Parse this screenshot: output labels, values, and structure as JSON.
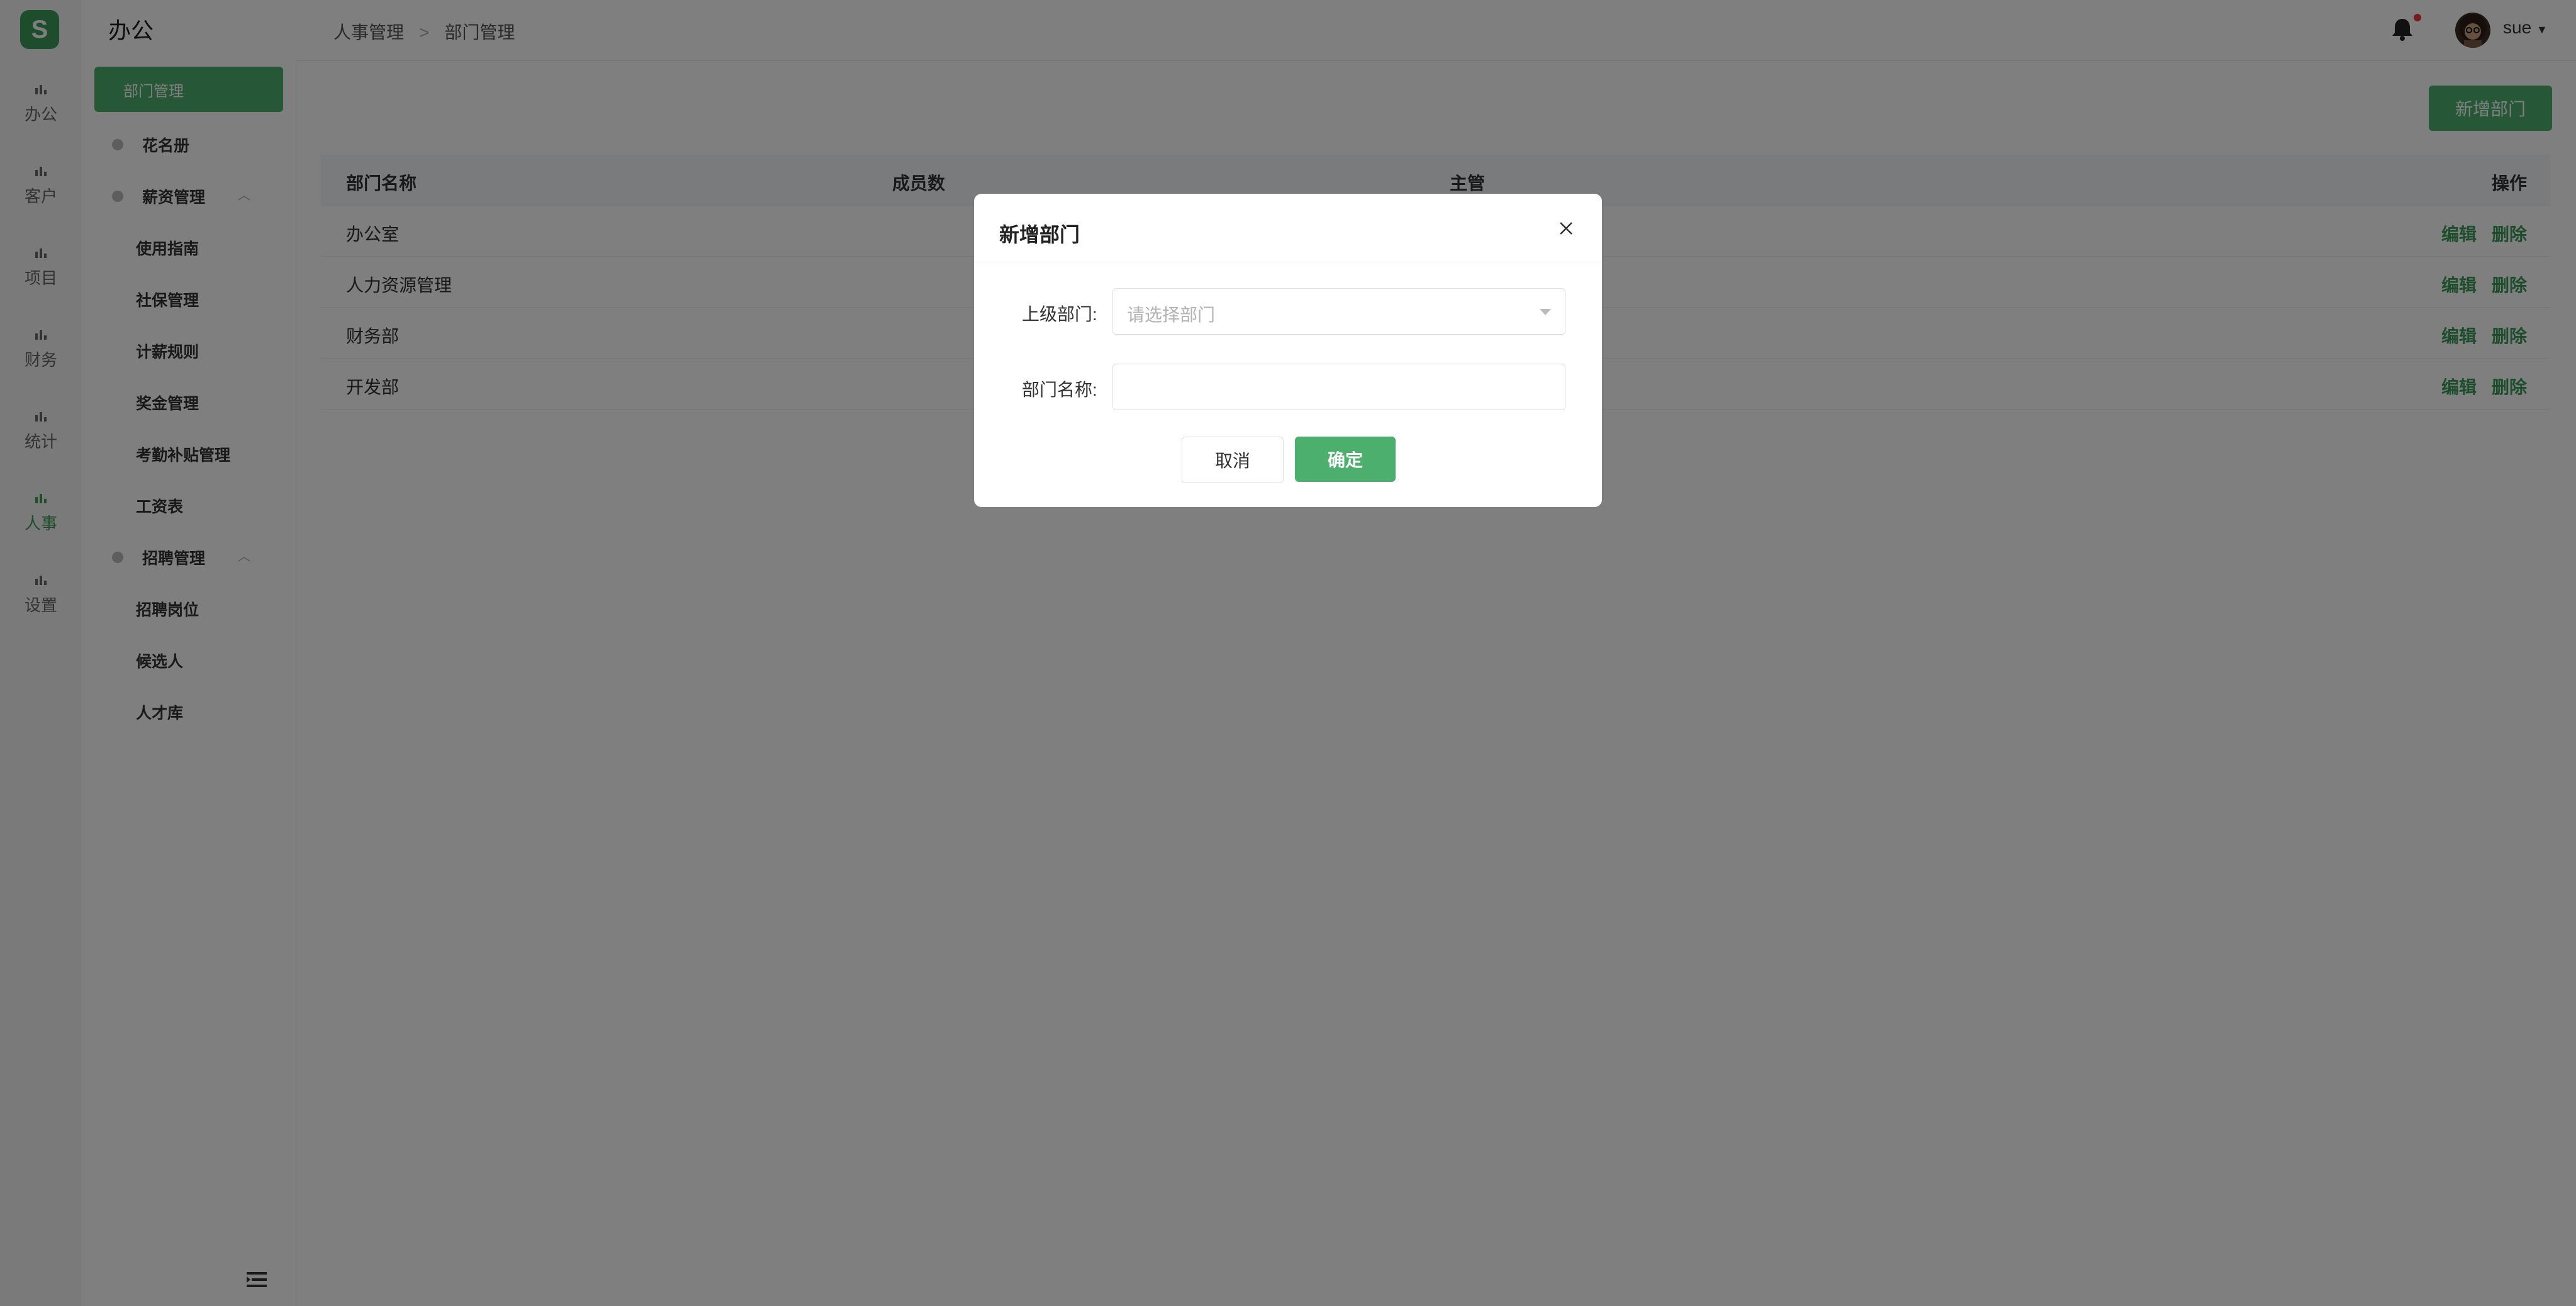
{
  "logo": {
    "letter": "S"
  },
  "rail": {
    "items": [
      {
        "label": "办公",
        "icon": "bar-chart-icon"
      },
      {
        "label": "客户",
        "icon": "bar-chart-icon"
      },
      {
        "label": "项目",
        "icon": "bar-chart-icon"
      },
      {
        "label": "财务",
        "icon": "bar-chart-icon"
      },
      {
        "label": "统计",
        "icon": "bar-chart-icon"
      },
      {
        "label": "人事",
        "icon": "bar-chart-icon",
        "active": true
      },
      {
        "label": "设置",
        "icon": "bar-chart-icon"
      }
    ]
  },
  "subnav": {
    "title": "办公",
    "active_item": "部门管理",
    "groups": [
      {
        "label": "花名册"
      },
      {
        "label": "薪资管理",
        "items": [
          "使用指南",
          "社保管理",
          "计薪规则",
          "奖金管理",
          "考勤补贴管理",
          "工资表"
        ]
      },
      {
        "label": "招聘管理",
        "items": [
          "招聘岗位",
          "候选人",
          "人才库"
        ]
      }
    ]
  },
  "header": {
    "breadcrumb": [
      "人事管理",
      "部门管理"
    ],
    "breadcrumb_sep": ">",
    "username": "sue"
  },
  "main": {
    "add_button": "新增部门",
    "table": {
      "columns": [
        "部门名称",
        "成员数",
        "主管",
        "操作"
      ],
      "rows": [
        {
          "name": "办公室",
          "edit": "编辑",
          "delete": "删除"
        },
        {
          "name": "人力资源管理",
          "edit": "编辑",
          "delete": "删除"
        },
        {
          "name": "财务部",
          "edit": "编辑",
          "delete": "删除"
        },
        {
          "name": "开发部",
          "edit": "编辑",
          "delete": "删除"
        }
      ]
    }
  },
  "modal": {
    "title": "新增部门",
    "parent_label": "上级部门:",
    "parent_placeholder": "请选择部门",
    "name_label": "部门名称:",
    "name_value": "",
    "cancel": "取消",
    "confirm": "确定"
  },
  "colors": {
    "accent": "#4caf6e",
    "badge": "#e03c3c"
  }
}
